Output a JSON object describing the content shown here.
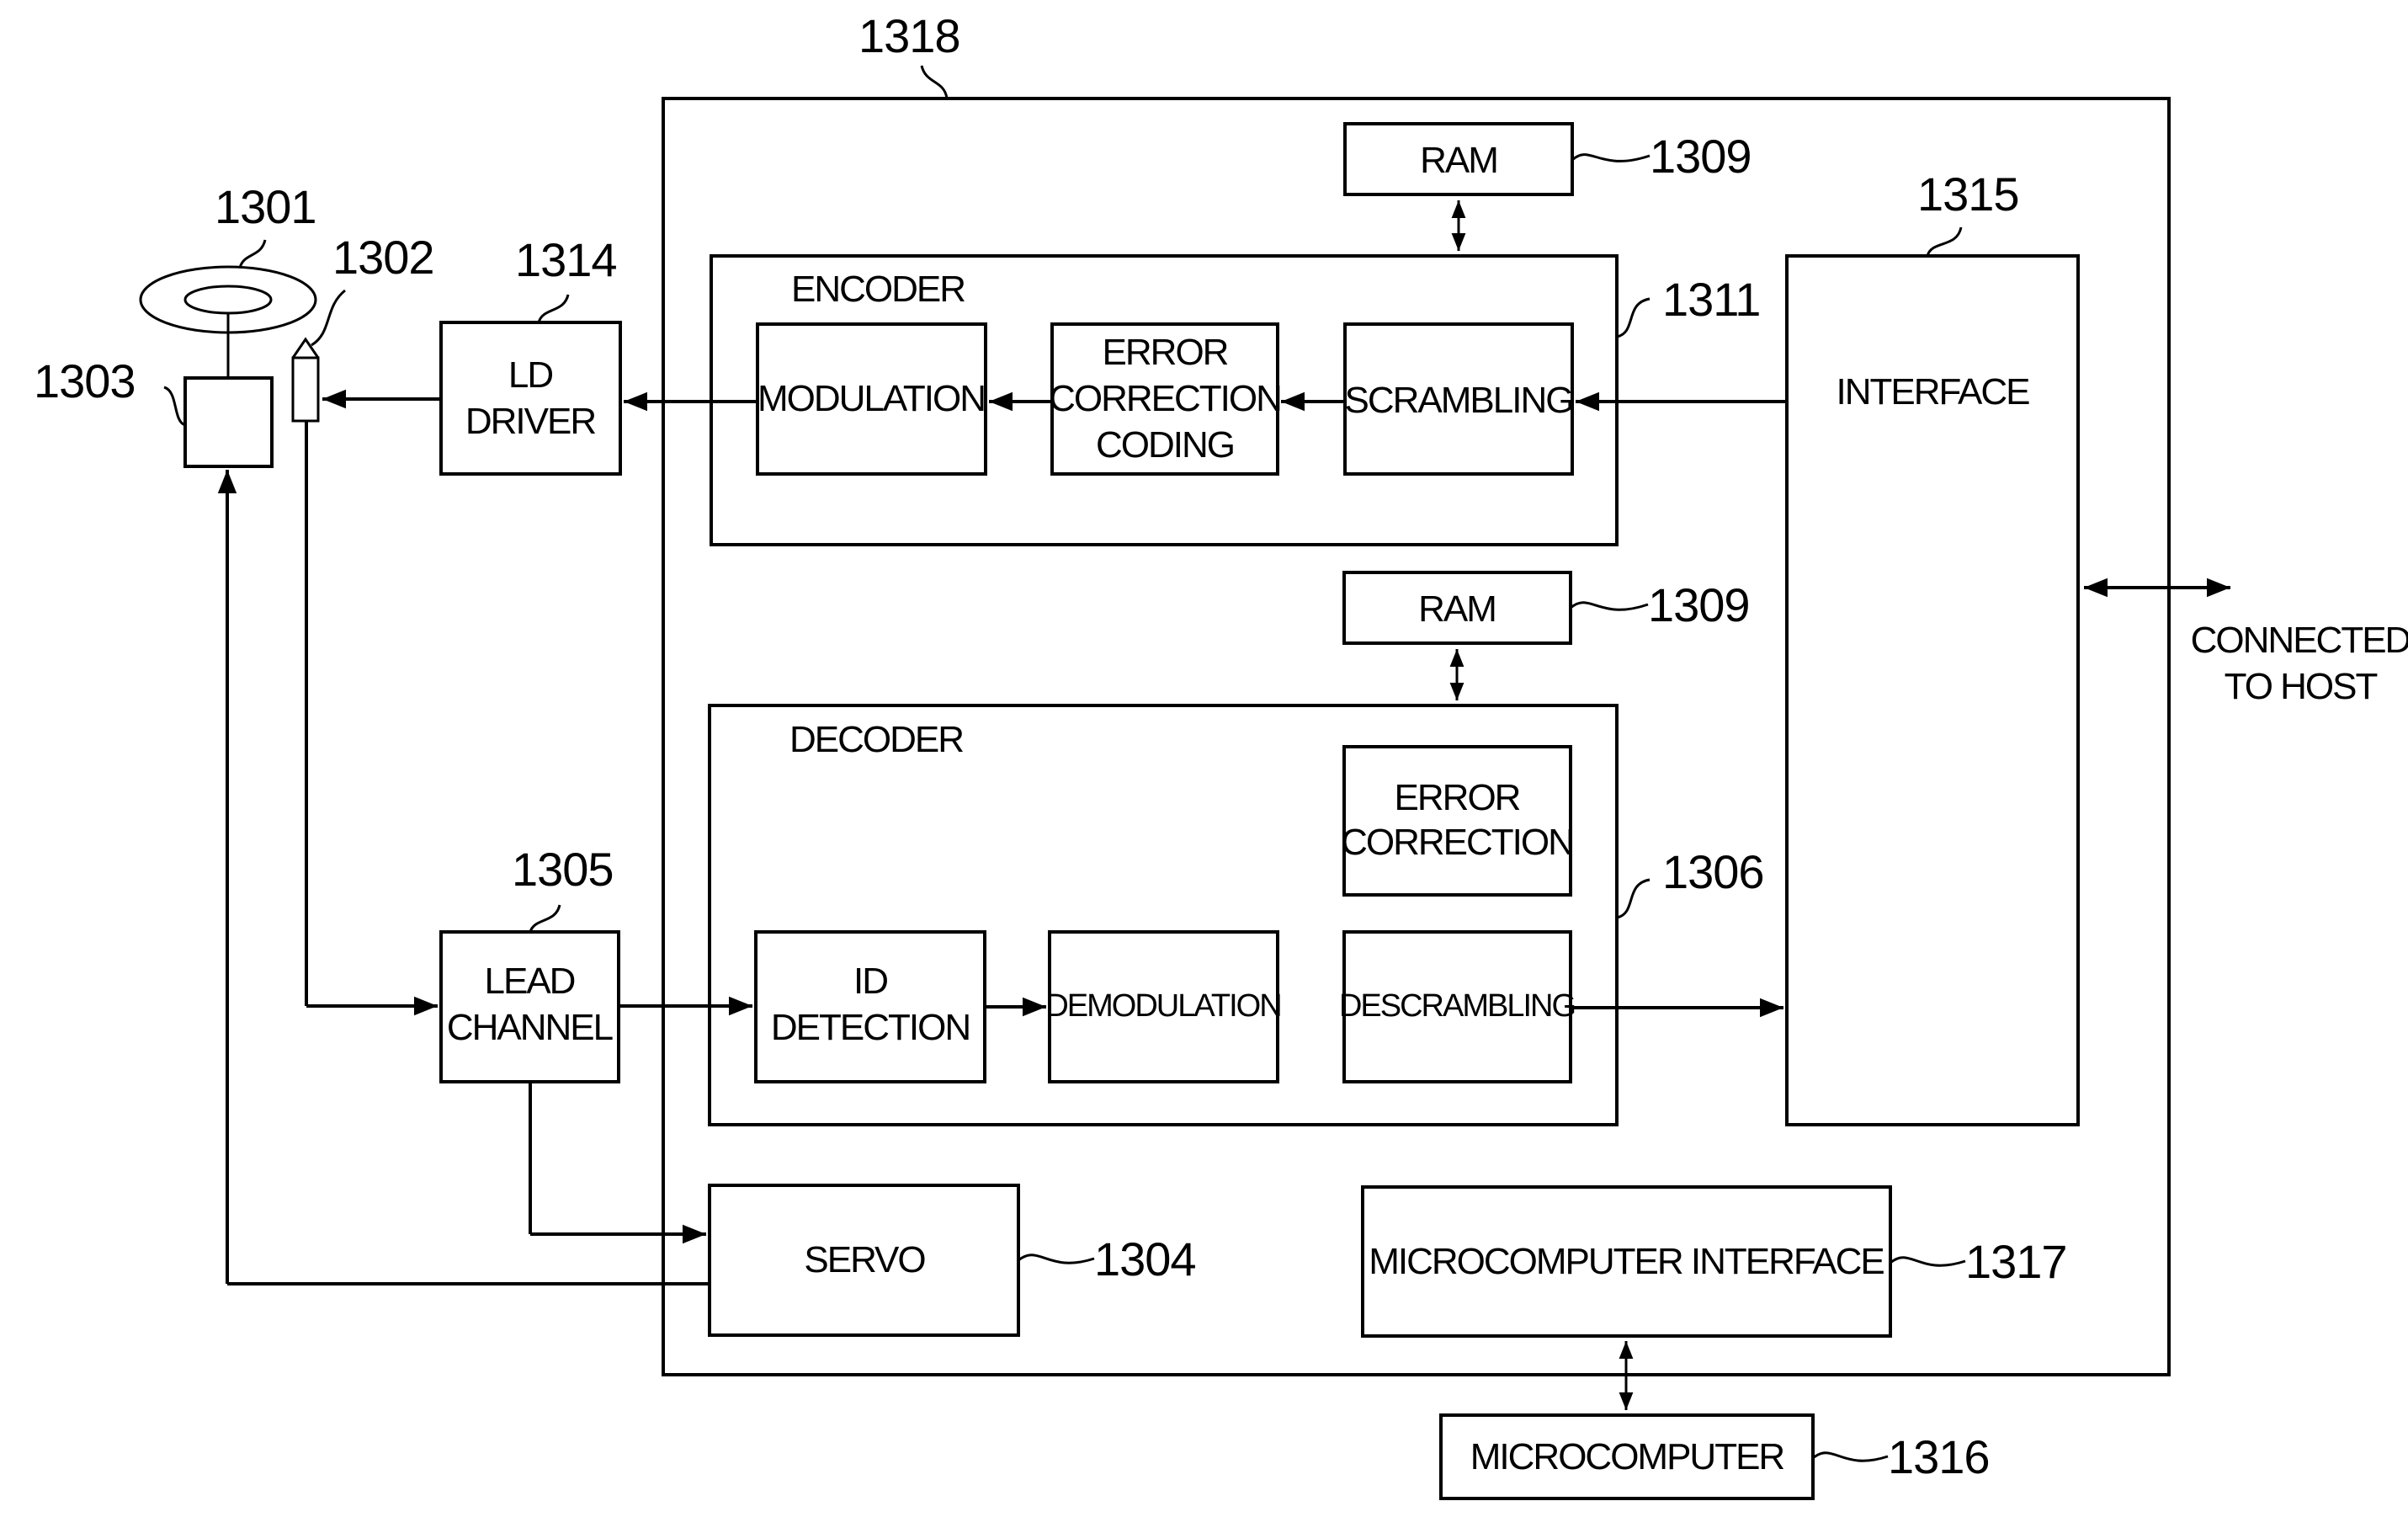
{
  "figure": {
    "refs": {
      "drive_system": "1318",
      "disc": "1301",
      "pickup": "1302",
      "motor": "1303",
      "servo": "1304",
      "lead_channel": "1305",
      "decoder": "1306",
      "ram_top": "1309",
      "ram_bottom": "1309",
      "encoder": "1311",
      "ld_driver": "1314",
      "interface": "1315",
      "microcomputer": "1316",
      "micro_interface": "1317"
    },
    "blocks": {
      "ram_top": [
        "RAM"
      ],
      "ram_bottom": [
        "RAM"
      ],
      "encoder_title": "ENCODER",
      "decoder_title": "DECODER",
      "modulation": [
        "MODULATION"
      ],
      "ecc": [
        "ERROR",
        "CORRECTION",
        "CODING"
      ],
      "scrambling": [
        "SCRAMBLING"
      ],
      "error_correction": [
        "ERROR",
        "CORRECTION"
      ],
      "id_detection": [
        "ID",
        "DETECTION"
      ],
      "demodulation": [
        "DEMODULATION"
      ],
      "descrambling": [
        "DESCRAMBLING"
      ],
      "interface": [
        "INTERFACE"
      ],
      "ld_driver": [
        "LD",
        "DRIVER"
      ],
      "lead_channel": [
        "LEAD",
        "CHANNEL"
      ],
      "servo": [
        "SERVO"
      ],
      "micro_interface": [
        "MICROCOMPUTER INTERFACE"
      ],
      "microcomputer": [
        "MICROCOMPUTER"
      ]
    },
    "host_label": [
      "CONNECTED",
      "TO HOST"
    ]
  }
}
